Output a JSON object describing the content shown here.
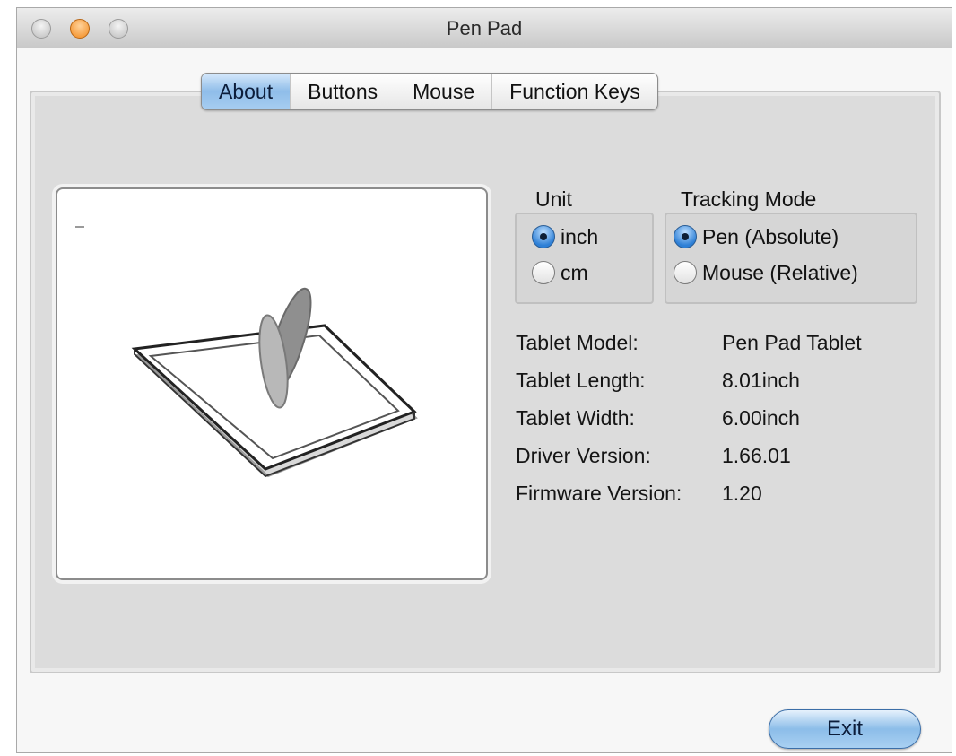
{
  "window": {
    "title": "Pen Pad"
  },
  "tabs": [
    {
      "label": "About",
      "active": true
    },
    {
      "label": "Buttons",
      "active": false
    },
    {
      "label": "Mouse",
      "active": false
    },
    {
      "label": "Function Keys",
      "active": false
    }
  ],
  "unit": {
    "label": "Unit",
    "options": [
      {
        "label": "inch",
        "selected": true
      },
      {
        "label": "cm",
        "selected": false
      }
    ]
  },
  "tracking_mode": {
    "label": "Tracking Mode",
    "options": [
      {
        "label": "Pen (Absolute)",
        "selected": true
      },
      {
        "label": "Mouse (Relative)",
        "selected": false
      }
    ]
  },
  "info": {
    "model": {
      "label": "Tablet Model:",
      "value": "Pen Pad Tablet"
    },
    "length": {
      "label": "Tablet Length:",
      "value": "8.01inch"
    },
    "width": {
      "label": "Tablet Width:",
      "value": "6.00inch"
    },
    "driver": {
      "label": "Driver Version:",
      "value": "1.66.01"
    },
    "firmware": {
      "label": "Firmware Version:",
      "value": "1.20"
    }
  },
  "footer": {
    "exit_label": "Exit"
  },
  "colors": {
    "accent": "#8fbde9",
    "minimize": "#f28a1e",
    "pane": "#dcdcdc"
  },
  "icons": {
    "preview": "tablet-with-pen-illustration"
  }
}
